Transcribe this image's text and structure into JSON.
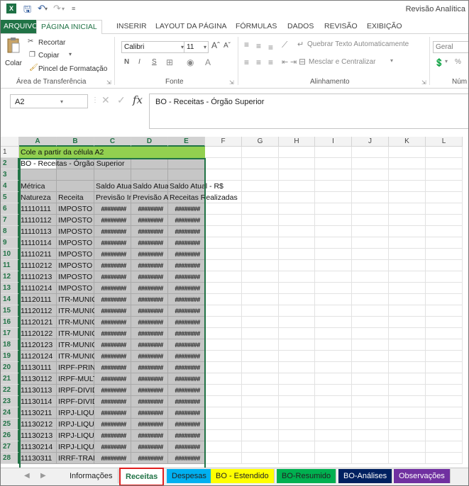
{
  "window_title": "Revisão Analítica",
  "ribbon_tabs": [
    "ARQUIVO",
    "PÁGINA INICIAL",
    "INSERIR",
    "LAYOUT DA PÁGINA",
    "FÓRMULAS",
    "DADOS",
    "REVISÃO",
    "EXIBIÇÃO"
  ],
  "ribbon": {
    "paste": "Colar",
    "cut": "Recortar",
    "copy": "Copiar",
    "format_painter": "Pincel de Formatação",
    "clipboard_group": "Área de Transferência",
    "font_name": "Calibri",
    "font_size": "11",
    "bold": "N",
    "italic": "I",
    "underline": "S",
    "font_group": "Fonte",
    "wrap_text": "Quebrar Texto Automaticamente",
    "merge_center": "Mesclar e Centralizar",
    "alignment_group": "Alinhamento",
    "number_format": "Geral",
    "percent": "%",
    "number_group": "Núm"
  },
  "name_box": "A2",
  "formula_content": "BO - Receitas - Órgão Superior",
  "fx_label": "fx",
  "columns": [
    "A",
    "B",
    "C",
    "D",
    "E",
    "F",
    "G",
    "H",
    "I",
    "J",
    "K",
    "L"
  ],
  "cells": {
    "r1a": "Cole a partir da célula A2",
    "r2a": "BO - Receitas - Órgão Superior",
    "r4a": "Métrica",
    "r4c": "Saldo Atual",
    "r4d": "Saldo Atual",
    "r4e": "Saldo Atual - R$",
    "r5a": "Natureza",
    "r5b": "Receita",
    "r5c": "Previsão Inicial",
    "r5d": "Previsão Atualizada",
    "r5e": "Receitas Realizadas"
  },
  "hash_value": "########",
  "data_rows": [
    {
      "row": "6",
      "code": "11110111",
      "desc": "IMPOSTO"
    },
    {
      "row": "7",
      "code": "11110112",
      "desc": "IMPOSTO"
    },
    {
      "row": "8",
      "code": "11110113",
      "desc": "IMPOSTO"
    },
    {
      "row": "9",
      "code": "11110114",
      "desc": "IMPOSTO"
    },
    {
      "row": "10",
      "code": "11110211",
      "desc": "IMPOSTO"
    },
    {
      "row": "11",
      "code": "11110212",
      "desc": "IMPOSTO"
    },
    {
      "row": "12",
      "code": "11110213",
      "desc": "IMPOSTO"
    },
    {
      "row": "13",
      "code": "11110214",
      "desc": "IMPOSTO"
    },
    {
      "row": "14",
      "code": "11120111",
      "desc": "ITR-MUNICIPAL"
    },
    {
      "row": "15",
      "code": "11120112",
      "desc": "ITR-MUNICIPAL"
    },
    {
      "row": "16",
      "code": "11120121",
      "desc": "ITR-MUNICIPAL"
    },
    {
      "row": "17",
      "code": "11120122",
      "desc": "ITR-MUNICIPAL"
    },
    {
      "row": "18",
      "code": "11120123",
      "desc": "ITR-MUNICIPAL"
    },
    {
      "row": "19",
      "code": "11120124",
      "desc": "ITR-MUNICIPAL"
    },
    {
      "row": "20",
      "code": "11130111",
      "desc": "IRPF-PRINCIPAL"
    },
    {
      "row": "21",
      "code": "11130112",
      "desc": "IRPF-MULTA"
    },
    {
      "row": "22",
      "code": "11130113",
      "desc": "IRPF-DIVIDA"
    },
    {
      "row": "23",
      "code": "11130114",
      "desc": "IRPF-DIVIDA"
    },
    {
      "row": "24",
      "code": "11130211",
      "desc": "IRPJ-LIQUIDO"
    },
    {
      "row": "25",
      "code": "11130212",
      "desc": "IRPJ-LIQUIDO"
    },
    {
      "row": "26",
      "code": "11130213",
      "desc": "IRPJ-LIQUIDO"
    },
    {
      "row": "27",
      "code": "11130214",
      "desc": "IRPJ-LIQUIDO"
    },
    {
      "row": "28",
      "code": "11130311",
      "desc": "IRRF-TRABALHO"
    }
  ],
  "sheet_tabs": [
    {
      "label": "Informações",
      "color": "#f0f0f0",
      "text": "#222222"
    },
    {
      "label": "Receitas",
      "color": "#ffffff",
      "text": "#217346"
    },
    {
      "label": "Despesas",
      "color": "#00b0f0",
      "text": "#222222"
    },
    {
      "label": "BO - Estendido",
      "color": "#ffff00",
      "text": "#222222"
    },
    {
      "label": "BO-Resumido",
      "color": "#00b050",
      "text": "#222222"
    },
    {
      "label": "BO-Análises",
      "color": "#002060",
      "text": "#ffffff"
    },
    {
      "label": "Observações",
      "color": "#7030a0",
      "text": "#ffffff"
    }
  ],
  "colors": {
    "excel_green": "#217346",
    "cell_green": "#92d050",
    "highlight_red": "#e01e1e"
  }
}
